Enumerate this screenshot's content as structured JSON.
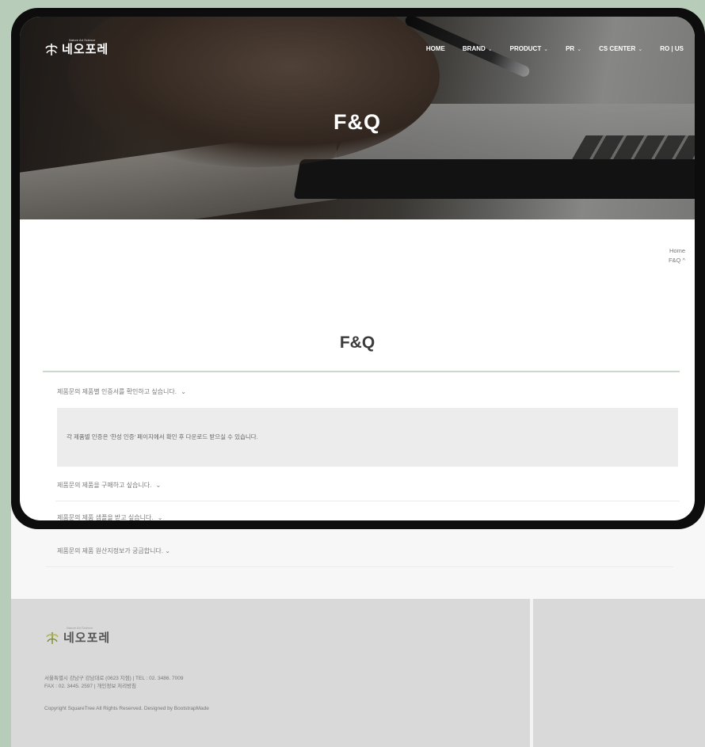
{
  "site": {
    "brand_name": "네오포레",
    "brand_tagline": "Nature Art Science"
  },
  "nav": {
    "items": [
      {
        "label": "HOME",
        "has_dropdown": false
      },
      {
        "label": "BRAND",
        "has_dropdown": true
      },
      {
        "label": "PRODUCT",
        "has_dropdown": true
      },
      {
        "label": "PR",
        "has_dropdown": true
      },
      {
        "label": "CS CENTER",
        "has_dropdown": true
      },
      {
        "label": "RO | US",
        "has_dropdown": false
      }
    ]
  },
  "hero": {
    "title": "F&Q"
  },
  "breadcrumb": {
    "home": "Home",
    "current": "F&Q ^"
  },
  "page": {
    "title": "F&Q"
  },
  "faq": {
    "items": [
      {
        "question": "제품문의 제품별 인증서를 확인하고 싶습니다.",
        "expanded": true,
        "answer": "각 제품별 인증은 '한성 인증' 페이지에서 확인 후 다운로드 받으실 수 있습니다."
      },
      {
        "question": "제품문의 제품을 구매하고 싶습니다.",
        "expanded": false
      },
      {
        "question": "제품문의 제품 샘플을 받고 싶습니다.",
        "expanded": false
      },
      {
        "question": "제품문의 제품 원산지정보가 궁금합니다.",
        "expanded": false
      }
    ]
  },
  "footer": {
    "address_line1": "서울특별시 강남구 강남대로 (0623 지점) | TEL : 02. 3486. 7009",
    "address_line2": "FAX : 02. 3445. 2597 | 개인정보 처리방침",
    "copyright": "Copyright SquareTree All Rights Reserved. Designed by BootstrapMade"
  },
  "colors": {
    "background_frame": "#b7cdb9",
    "device_bezel": "#0d0d0d",
    "accent_rule": "#c9d8cb",
    "footer_bg": "#d9d9d9",
    "answer_bg": "#ececec"
  }
}
